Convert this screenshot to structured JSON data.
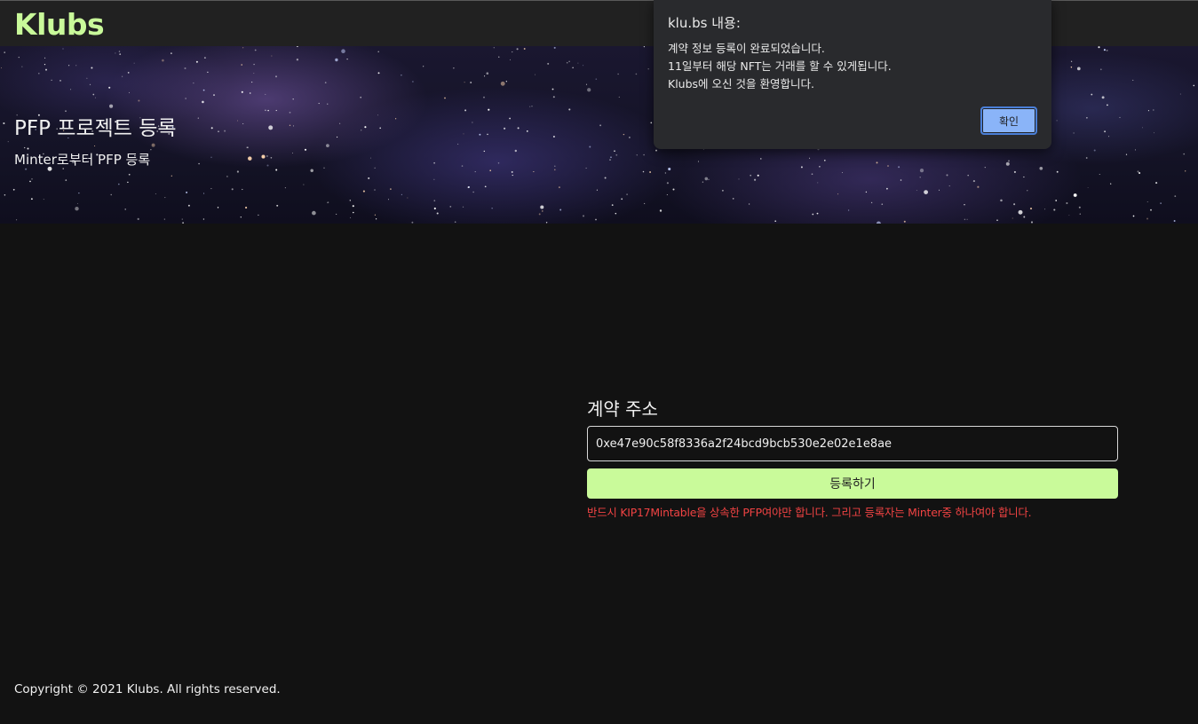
{
  "navbar": {
    "brand": "Klubs"
  },
  "hero": {
    "title": "PFP 프로젝트 등록",
    "subtitle": "Minter로부터 PFP 등록"
  },
  "form": {
    "label": "계약 주소",
    "address_value": "0xe47e90c58f8336a2f24bcd9bcb530e2e02e1e8ae",
    "submit_label": "등록하기",
    "warning": "반드시 KIP17Mintable을 상속한 PFP여야만 합니다. 그리고 등록자는 Minter중 하나여야 합니다."
  },
  "footer": {
    "copyright": "Copyright © 2021 Klubs. All rights reserved."
  },
  "alert": {
    "title": "klu.bs 내용:",
    "lines": [
      "계약 정보 등록이 완료되었습니다.",
      "11일부터 해당 NFT는 거래를 할 수 있게됩니다.",
      "Klubs에 오신 것을 환영합니다."
    ],
    "ok_label": "확인"
  },
  "colors": {
    "accent": "#c9fa9a",
    "background": "#121212",
    "warning": "#f04343",
    "dialog_button": "#8ab4f8"
  }
}
